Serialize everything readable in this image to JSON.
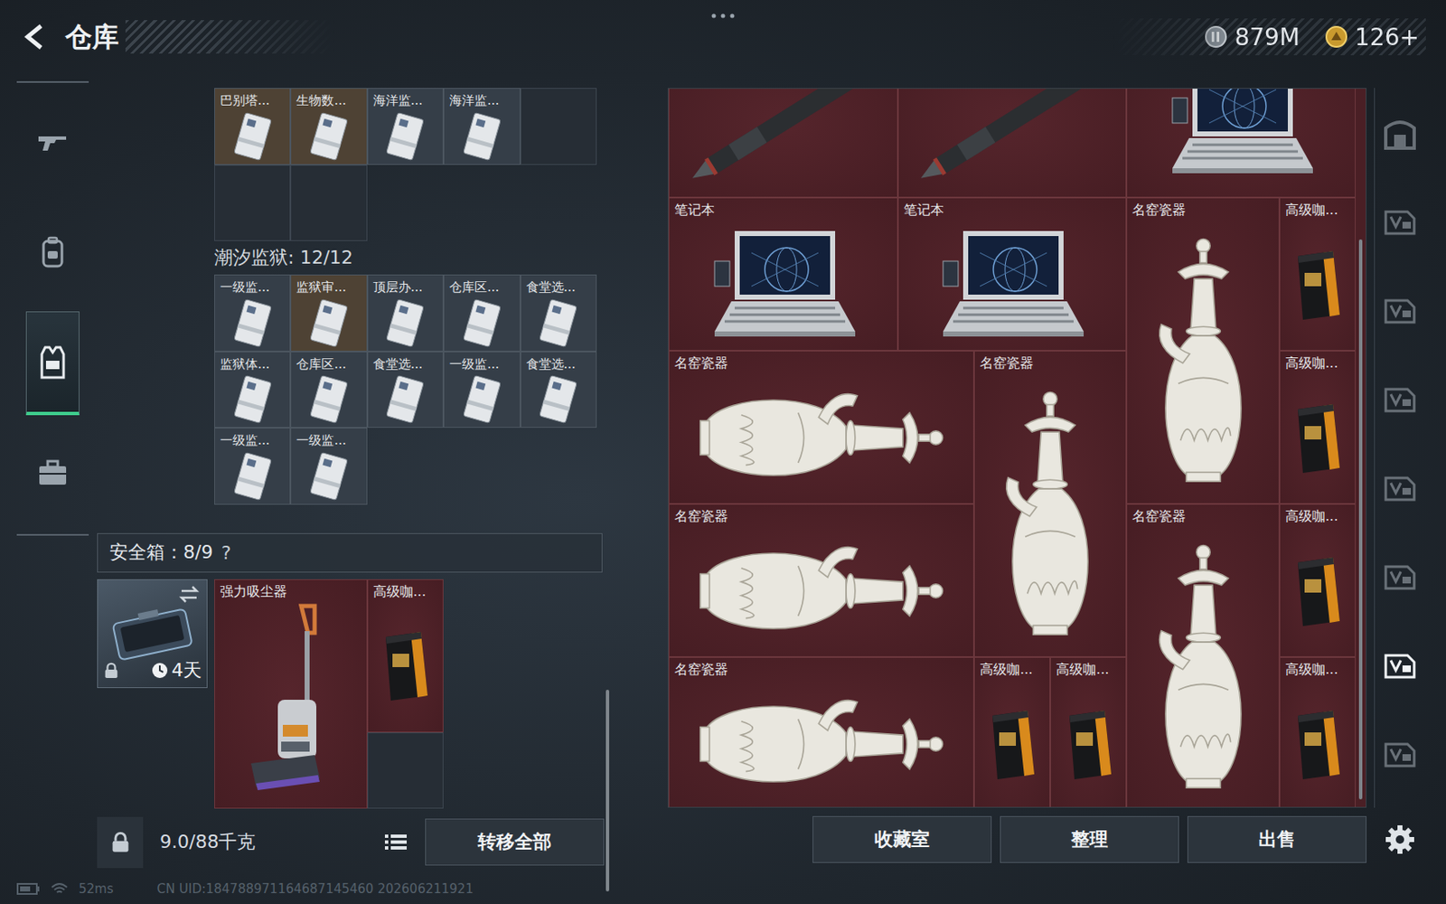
{
  "topbar": {
    "title": "仓库",
    "currencies": [
      {
        "kind": "silver",
        "amount": "879M"
      },
      {
        "kind": "gold",
        "amount": "126+"
      }
    ]
  },
  "sidebar": {
    "items": [
      {
        "kind": "weapon",
        "selected": false
      },
      {
        "kind": "backpack",
        "selected": false
      },
      {
        "kind": "vest",
        "selected": true
      },
      {
        "kind": "case",
        "selected": false
      }
    ]
  },
  "loadout": {
    "top_cells": [
      {
        "kind": "card",
        "name": "巴别塔...",
        "color": "#4e4234"
      },
      {
        "kind": "card",
        "name": "生物数...",
        "color": "#4e4234"
      },
      {
        "kind": "card",
        "name": "海洋监...",
        "color": "#353e48"
      },
      {
        "kind": "card",
        "name": "海洋监...",
        "color": "#353e48"
      },
      {
        "kind": "empty"
      },
      {
        "kind": "empty"
      },
      {
        "kind": "empty"
      }
    ],
    "sections": [
      {
        "title": "潮汐监狱: 12/12",
        "cells": [
          {
            "kind": "card",
            "name": "一级监...",
            "color": "#353e48"
          },
          {
            "kind": "card",
            "name": "监狱审...",
            "color": "#4e4234"
          },
          {
            "kind": "card",
            "name": "顶层办...",
            "color": "#353e48"
          },
          {
            "kind": "card",
            "name": "仓库区...",
            "color": "#353e48"
          },
          {
            "kind": "card",
            "name": "食堂选...",
            "color": "#353e48"
          },
          {
            "kind": "card",
            "name": "监狱体...",
            "color": "#353e48"
          },
          {
            "kind": "card",
            "name": "仓库区...",
            "color": "#353e48"
          },
          {
            "kind": "card",
            "name": "食堂选...",
            "color": "#353e48"
          },
          {
            "kind": "card",
            "name": "一级监...",
            "color": "#353e48"
          },
          {
            "kind": "card",
            "name": "食堂选...",
            "color": "#353e48"
          },
          {
            "kind": "card",
            "name": "一级监...",
            "color": "#353e48"
          },
          {
            "kind": "card",
            "name": "一级监...",
            "color": "#353e48"
          }
        ]
      }
    ],
    "safe_box": {
      "title": "安全箱：8/9",
      "help": "?",
      "container": {
        "timer": "4天",
        "locked": true
      },
      "cells": [
        {
          "kind": "vacuum",
          "name": "强力吸尘器"
        },
        {
          "kind": "coffee",
          "name": "高级咖..."
        },
        {
          "kind": "empty"
        }
      ]
    },
    "scroll": {
      "start": 0.72,
      "size": 0.28
    },
    "weight": "9.0/88千克",
    "transfer_button": "转移全部"
  },
  "stash": {
    "items": [
      {
        "kind": "missile"
      },
      {
        "kind": "missile"
      },
      {
        "kind": "laptop"
      },
      {
        "kind": "laptop",
        "name": "笔记本"
      },
      {
        "kind": "laptop",
        "name": "笔记本"
      },
      {
        "kind": "vase-v",
        "name": "名窑瓷器"
      },
      {
        "kind": "coffee",
        "name": "高级咖..."
      },
      {
        "kind": "vase-h",
        "name": "名窑瓷器"
      },
      {
        "kind": "vase-v",
        "name": "名窑瓷器"
      },
      {
        "kind": "coffee",
        "name": "高级咖..."
      },
      {
        "kind": "vase-h",
        "name": "名窑瓷器"
      },
      {
        "kind": "vase-v",
        "name": "名窑瓷器"
      },
      {
        "kind": "coffee",
        "name": "高级咖..."
      },
      {
        "kind": "vase-h",
        "name": "名窑瓷器"
      },
      {
        "kind": "coffee",
        "name": "高级咖..."
      },
      {
        "kind": "coffee",
        "name": "高级咖..."
      },
      {
        "kind": "coffee",
        "name": "高级咖..."
      }
    ],
    "scroll": {
      "start": 0.21,
      "size": 0.78
    }
  },
  "actions": [
    "收藏室",
    "整理",
    "出售"
  ],
  "side_tabs": [
    {
      "kind": "home",
      "selected": false
    },
    {
      "kind": "page",
      "selected": false
    },
    {
      "kind": "page",
      "selected": false
    },
    {
      "kind": "page",
      "selected": false
    },
    {
      "kind": "page",
      "selected": false
    },
    {
      "kind": "page",
      "selected": false
    },
    {
      "kind": "page",
      "selected": true
    },
    {
      "kind": "page",
      "selected": false
    }
  ],
  "status_bar": {
    "ping": "52ms",
    "uid": "CN UID:184788971164687145460 202606211921"
  }
}
